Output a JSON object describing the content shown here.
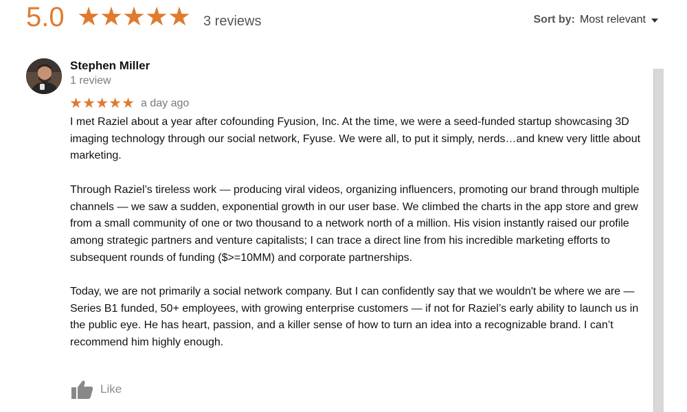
{
  "summary": {
    "rating": "5.0",
    "rating_value": 5.0,
    "stars": [
      "★",
      "★",
      "★",
      "★",
      "★"
    ],
    "review_count_text": "3 reviews",
    "accent_color": "#e07a2f"
  },
  "sort": {
    "label": "Sort by:",
    "value": "Most relevant"
  },
  "review": {
    "author": "Stephen Miller",
    "author_meta": "1 review",
    "stars": [
      "★",
      "★",
      "★",
      "★",
      "★"
    ],
    "time": "a day ago",
    "paragraphs": [
      "I met Raziel about a year after cofounding Fyusion, Inc. At the time, we were a seed-funded startup showcasing 3D imaging technology through our social network, Fyuse. We were all, to put it simply, nerds…and knew very little about marketing.",
      "Through Raziel’s tireless work — producing viral videos, organizing influencers, promoting our brand through multiple channels — we saw a sudden, exponential growth in our user base. We climbed the charts in the app store and grew from a small community of one or two thousand to a network north of a million. His vision instantly raised our profile among strategic partners and venture capitalists; I can trace a direct line from his incredible marketing efforts to subsequent rounds of funding ($>=10MM) and corporate partnerships.",
      "Today, we are not primarily a social network company. But I can confidently say that we wouldn't be where we are — Series B1 funded, 50+ employees, with growing enterprise customers — if not for Raziel’s early ability to launch us in the public eye. He has heart, passion, and a killer sense of how to turn an idea into a recognizable brand. I can’t recommend him highly enough."
    ],
    "like_label": "Like",
    "like_icon": "thumbs-up-icon"
  }
}
